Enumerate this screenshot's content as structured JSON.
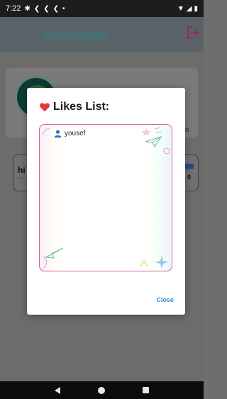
{
  "status_bar": {
    "time": "7:22"
  },
  "app_bar": {
    "title": "BrainyBaddies"
  },
  "background": {
    "profile_fragment": "m",
    "post_text": "hi",
    "comment_count": "0"
  },
  "dialog": {
    "title": "Likes List:",
    "likes": [
      {
        "name": "yousef"
      }
    ],
    "close_label": "Close"
  },
  "colors": {
    "heart": "#e53935",
    "accent_blue": "#2a8de0",
    "border_pink": "#e05aa0",
    "logout": "#c2185b"
  },
  "icons": [
    "settings-icon",
    "chevron-icon",
    "wifi-icon",
    "signal-icon",
    "battery-icon",
    "back-arrow-icon",
    "logout-icon",
    "heart-icon",
    "user-icon",
    "paper-plane-icon",
    "comment-icon"
  ]
}
